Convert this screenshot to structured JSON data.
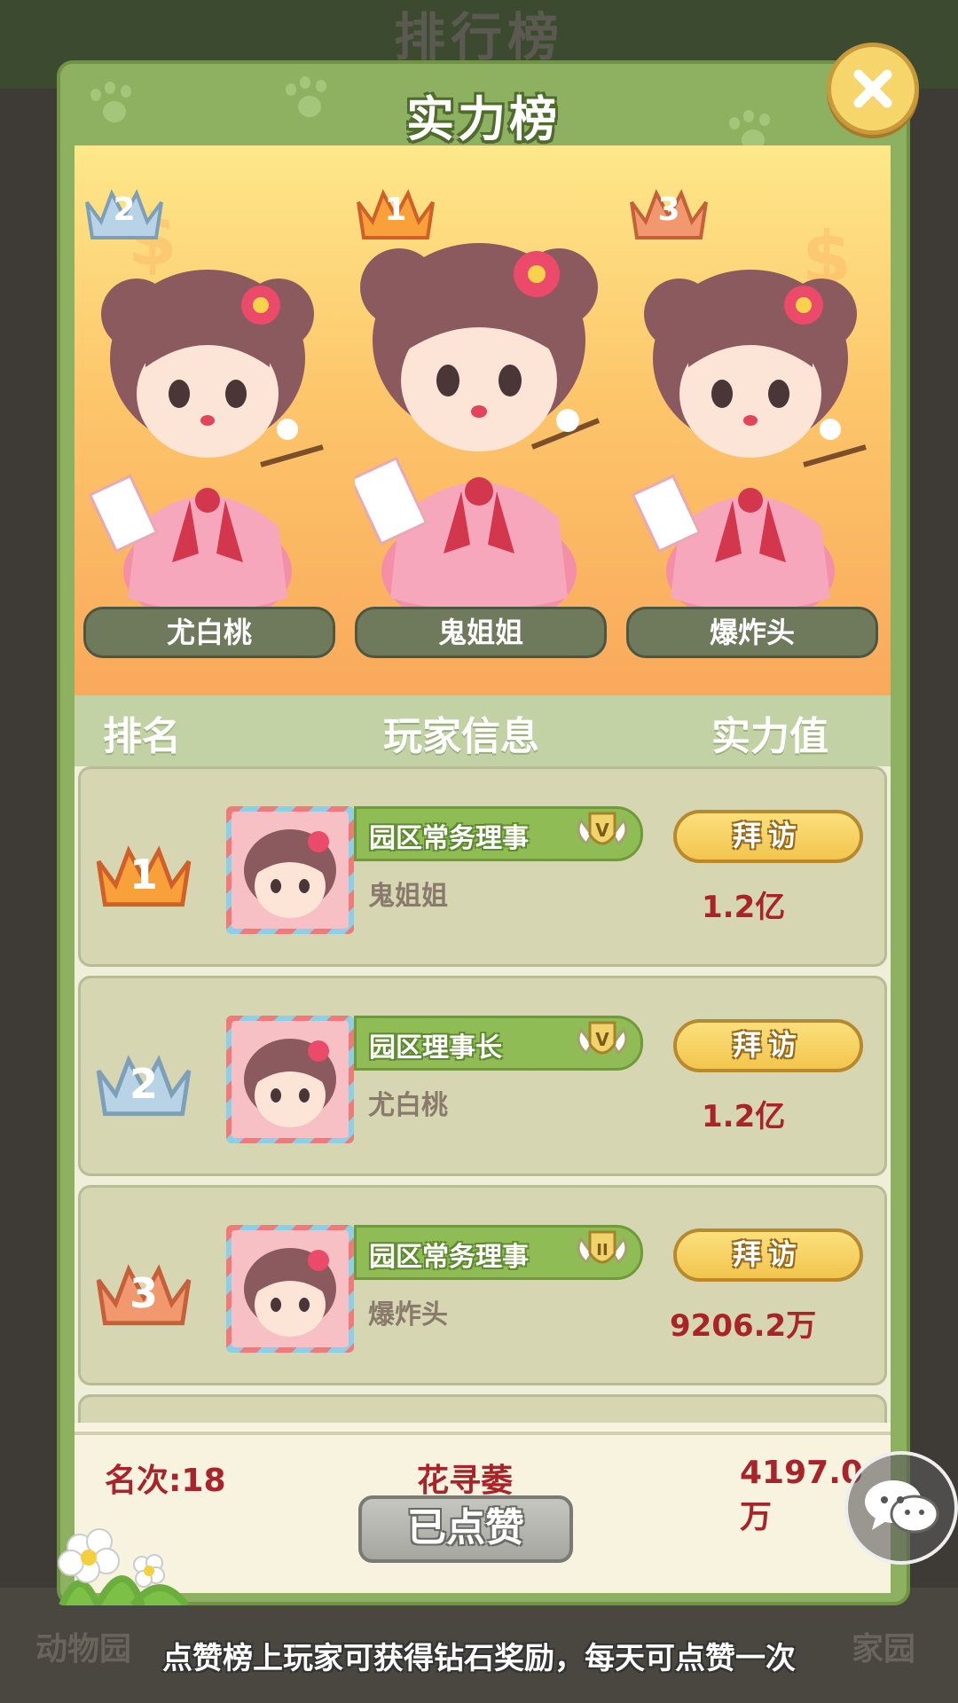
{
  "background": {
    "title": "排行榜",
    "nav": [
      "动物园",
      "家园"
    ]
  },
  "modal": {
    "title": "实力榜",
    "close_icon": "close-icon"
  },
  "podium": [
    {
      "rank": "2",
      "name": "尤白桃",
      "crown_color": "#b9d3e6"
    },
    {
      "rank": "1",
      "name": "鬼姐姐",
      "crown_color": "#f8a13a"
    },
    {
      "rank": "3",
      "name": "爆炸头",
      "crown_color": "#f2986e"
    }
  ],
  "list_header": {
    "rank": "排名",
    "info": "玩家信息",
    "power": "实力值"
  },
  "rows": [
    {
      "rank": "1",
      "title": "园区常务理事",
      "badge": "V",
      "name": "鬼姐姐",
      "visit": "拜访",
      "power": "1.2亿"
    },
    {
      "rank": "2",
      "title": "园区理事长",
      "badge": "V",
      "name": "尤白桃",
      "visit": "拜访",
      "power": "1.2亿"
    },
    {
      "rank": "3",
      "title": "园区常务理事",
      "badge": "II",
      "name": "爆炸头",
      "visit": "拜访",
      "power": "9206.2万"
    }
  ],
  "me": {
    "rank": "名次:18",
    "name": "花寻萎",
    "power": "4197.0万",
    "liked_label": "已点赞"
  },
  "chat_icon": "chat-bubbles-icon",
  "tip": "点赞榜上玩家可获得钻石奖励，每天可点赞一次"
}
